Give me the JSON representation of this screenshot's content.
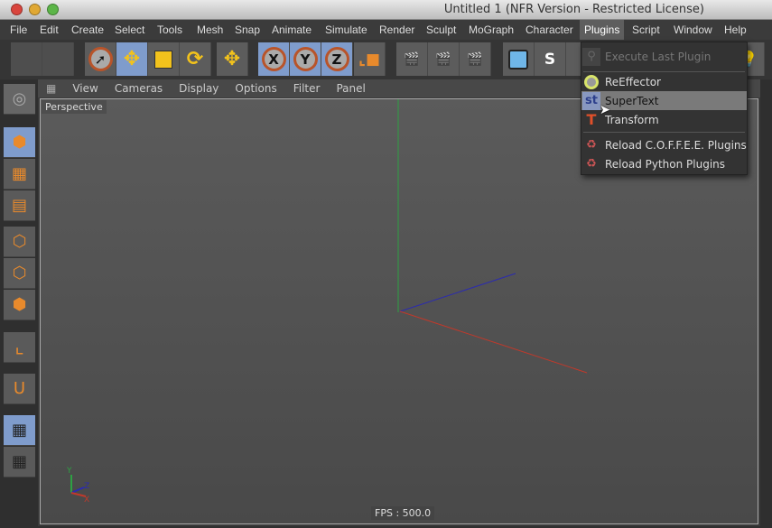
{
  "window": {
    "title": "Untitled 1 (NFR Version - Restricted License)"
  },
  "menubar": {
    "items": [
      "File",
      "Edit",
      "Create",
      "Select",
      "Tools",
      "Mesh",
      "Snap",
      "Animate",
      "Simulate",
      "Render",
      "Sculpt",
      "MoGraph",
      "Character",
      "Plugins",
      "Script",
      "Window",
      "Help"
    ],
    "active": "Plugins"
  },
  "toolbar": {
    "axis_x": "X",
    "axis_y": "Y",
    "axis_z": "Z"
  },
  "viewport": {
    "menu": [
      "View",
      "Cameras",
      "Display",
      "Options",
      "Filter",
      "Panel"
    ],
    "camera": "Perspective",
    "fps": "FPS : 500.0",
    "axis_labels": {
      "y": "Y",
      "z": "Z",
      "x": "X"
    },
    "colors": {
      "x": "#c0392b",
      "y": "#2ea043",
      "z": "#2b2bb0"
    }
  },
  "plugins_menu": {
    "items": [
      {
        "label": "Execute Last Plugin",
        "icon": "plugin-icon",
        "disabled": true
      },
      {
        "label": "ReEffector",
        "icon": "reeffector-icon"
      },
      {
        "label": "SuperText",
        "icon": "supertext-icon",
        "icon_text": "st",
        "highlighted": true
      },
      {
        "label": "Transform",
        "icon": "transform-icon",
        "icon_text": "T"
      },
      {
        "label": "Reload C.O.F.F.E.E. Plugins",
        "icon": "reload-icon"
      },
      {
        "label": "Reload Python Plugins",
        "icon": "reload-icon"
      }
    ]
  }
}
